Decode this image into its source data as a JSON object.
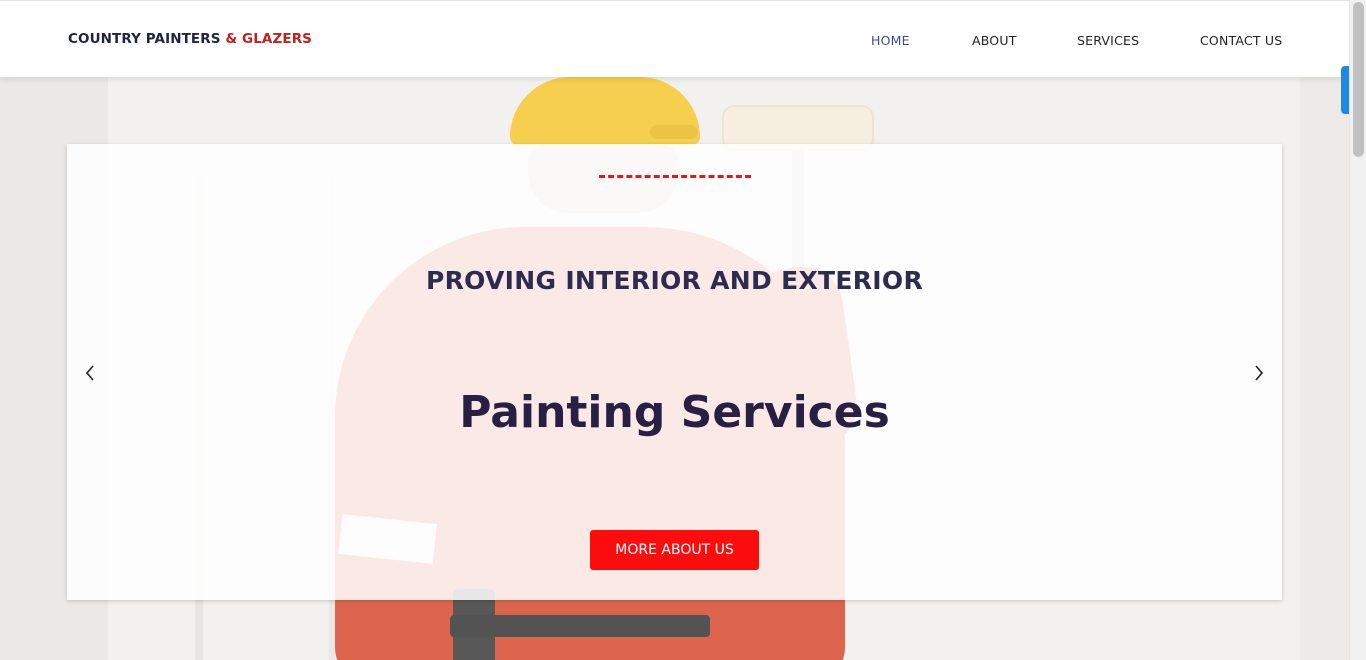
{
  "brand": {
    "name_main": "COUNTRY PAINTERS",
    "name_accent": "& GLAZERS"
  },
  "nav": [
    {
      "label": "HOME",
      "active": true
    },
    {
      "label": "ABOUT",
      "active": false
    },
    {
      "label": "SERVICES",
      "active": false
    },
    {
      "label": "CONTACT US",
      "active": false
    }
  ],
  "hero": {
    "subtitle": "PROVING INTERIOR AND EXTERIOR",
    "title": "Painting Services",
    "cta_label": "MORE ABOUT US",
    "prev_icon": "chevron-left-icon",
    "next_icon": "chevron-right-icon"
  },
  "colors": {
    "accent_red": "#c3201c",
    "button_red": "#fb0d0d",
    "nav_active": "#3f4b8f",
    "heading_dark": "#271f44",
    "scroll_marker_blue": "#1e88e5"
  }
}
